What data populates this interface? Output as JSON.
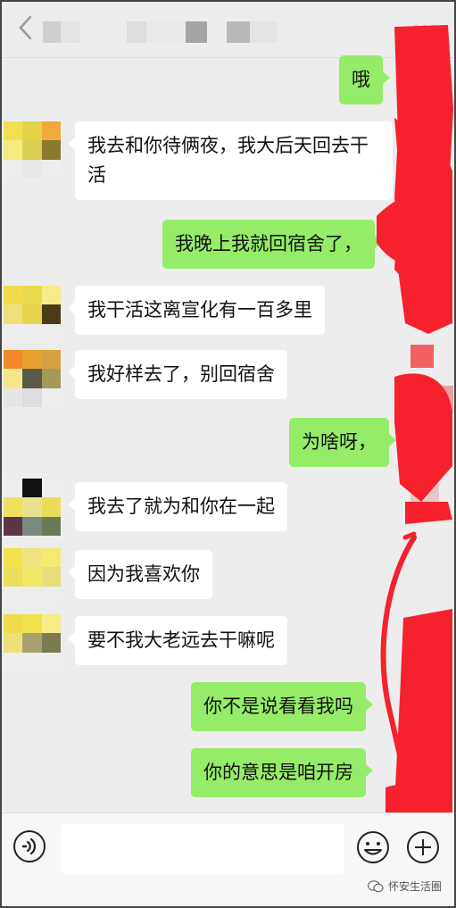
{
  "messages": {
    "m1": "哦",
    "m2": "我去和你待俩夜，我大后天回去干活",
    "m3": "我晚上我就回宿舍了，",
    "m4": "我干活这离宣化有一百多里",
    "m5": "我好样去了，别回宿舍",
    "m6": "为啥呀，",
    "m7": "我去了就为和你在一起",
    "m8": "因为我喜欢你",
    "m9": "要不我大老远去干嘛呢",
    "m10": "你不是说看看我吗",
    "m11": "你的意思是咱开房"
  },
  "input": {
    "value": "",
    "placeholder": ""
  },
  "watermark": "怀安生活圈",
  "icons": {
    "back": "chevron-left-icon",
    "menu": "more-icon",
    "voice": "voice-icon",
    "emoji": "emoji-icon",
    "plus": "plus-icon"
  },
  "colors": {
    "background": "#ededed",
    "incoming_bubble": "#ffffff",
    "outgoing_bubble": "#95ec69",
    "redaction": "#f5222d"
  }
}
